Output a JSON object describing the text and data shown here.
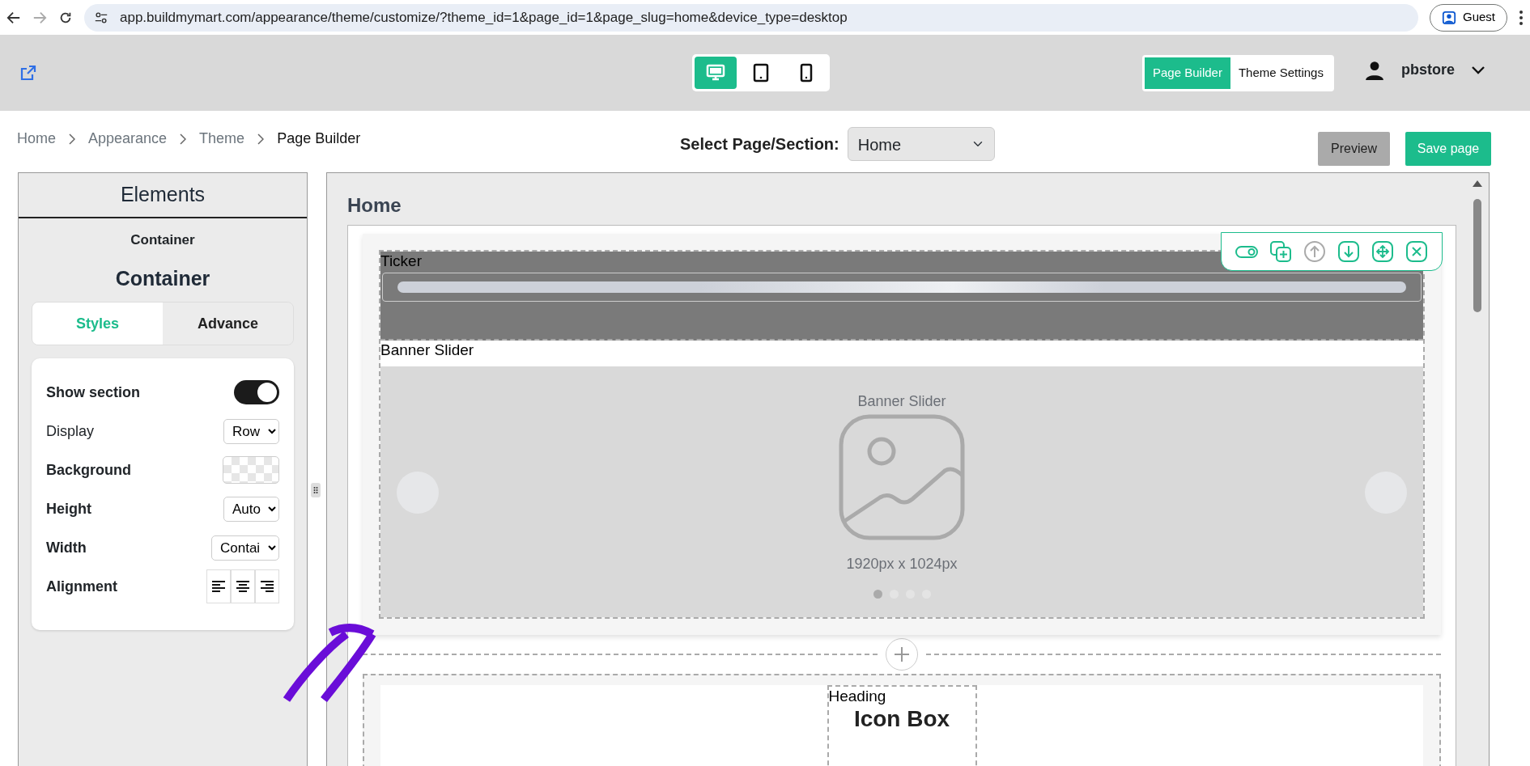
{
  "browser": {
    "url": "app.buildmymart.com/appearance/theme/customize/?theme_id=1&page_id=1&page_slug=home&device_type=desktop",
    "profile": "Guest"
  },
  "header": {
    "devices": [
      {
        "kind": "desktop",
        "selected": true
      },
      {
        "kind": "tablet",
        "selected": false
      },
      {
        "kind": "phone",
        "selected": false
      }
    ],
    "mode_tabs": [
      {
        "label": "Page Builder",
        "selected": true
      },
      {
        "label": "Theme Settings",
        "selected": false
      }
    ],
    "user": {
      "name": "pbstore"
    }
  },
  "breadcrumb": [
    "Home",
    "Appearance",
    "Theme",
    "Page Builder"
  ],
  "page_select": {
    "label": "Select Page/Section:",
    "value": "Home"
  },
  "actions": [
    {
      "kind": "preview",
      "label": "Preview"
    },
    {
      "kind": "save",
      "label": "Save page"
    }
  ],
  "elements_panel": {
    "title": "Elements",
    "subtitle": "Container",
    "heading": "Container",
    "tabs": [
      {
        "label": "Styles",
        "selected": true
      },
      {
        "label": "Advance",
        "selected": false
      }
    ],
    "settings": [
      {
        "kind": "toggle",
        "label": "Show section",
        "bold": true,
        "on": true
      },
      {
        "kind": "select",
        "label": "Display",
        "bold": false,
        "value": "Row"
      },
      {
        "kind": "swatch",
        "label": "Background",
        "bold": true
      },
      {
        "kind": "select",
        "label": "Height",
        "bold": true,
        "value": "Auto"
      },
      {
        "kind": "select",
        "label": "Width",
        "bold": true,
        "value": "Contai"
      },
      {
        "kind": "align",
        "label": "Alignment",
        "bold": true
      }
    ]
  },
  "canvas": {
    "title": "Home",
    "toolbar": [
      {
        "kind": "toggle",
        "disabled": false
      },
      {
        "kind": "duplicate",
        "disabled": false
      },
      {
        "kind": "up",
        "disabled": true
      },
      {
        "kind": "down",
        "disabled": false
      },
      {
        "kind": "move",
        "disabled": false
      },
      {
        "kind": "close",
        "disabled": false
      }
    ],
    "sections": [
      {
        "kind": "ticker",
        "label": "Ticker"
      },
      {
        "kind": "banner",
        "label": "Banner Slider",
        "caption": "Banner Slider",
        "size": "1920px x 1024px",
        "dots": [
          {
            "selected": true
          },
          {
            "selected": false
          },
          {
            "selected": false
          },
          {
            "selected": false
          }
        ]
      }
    ],
    "next_block": {
      "label": "Heading",
      "text": "Icon Box"
    }
  }
}
